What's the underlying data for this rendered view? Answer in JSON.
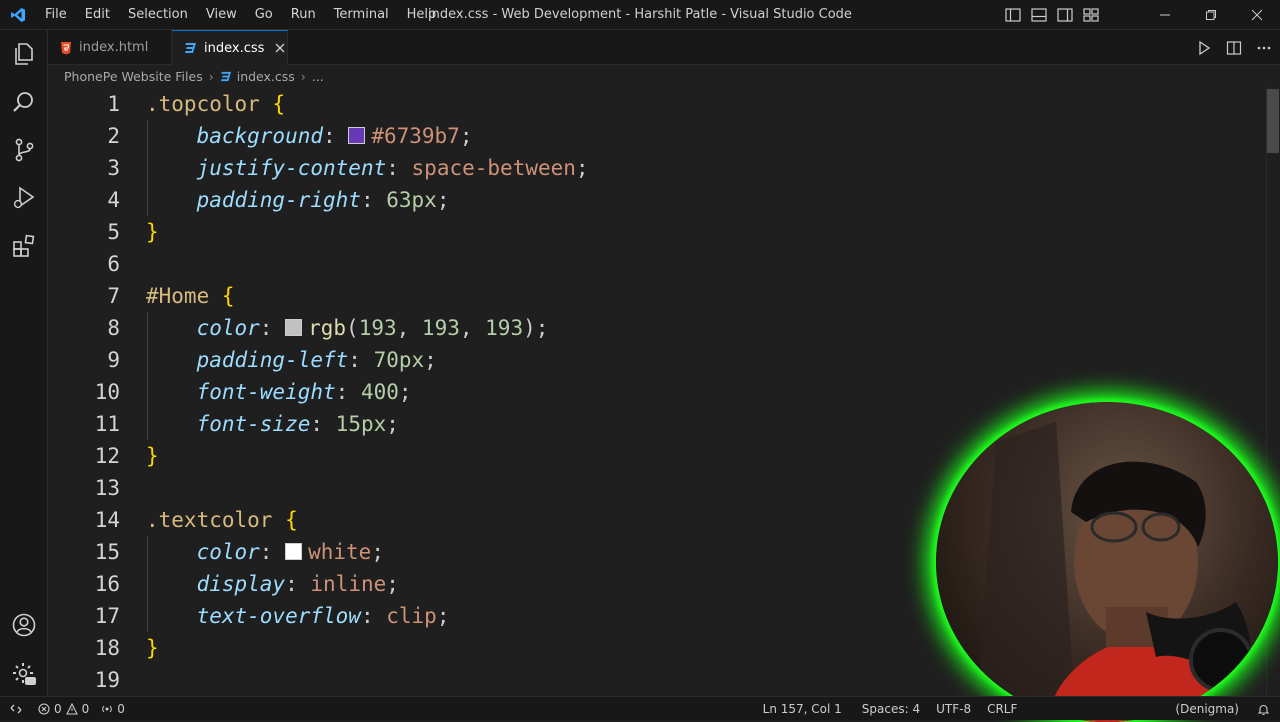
{
  "window": {
    "title": "index.css - Web Development - Harshit Patle - Visual Studio Code",
    "menu": [
      "File",
      "Edit",
      "Selection",
      "View",
      "Go",
      "Run",
      "Terminal",
      "Help"
    ]
  },
  "tabs": [
    {
      "label": "index.html",
      "icon": "html-file-icon",
      "active": false
    },
    {
      "label": "index.css",
      "icon": "css-file-icon",
      "active": true
    }
  ],
  "breadcrumb": {
    "folder": "PhonePe Website Files",
    "file": "index.css",
    "more": "..."
  },
  "activity_bar": [
    "explorer-icon",
    "search-icon",
    "source-control-icon",
    "run-debug-icon",
    "extensions-icon",
    "accounts-icon",
    "manage-gear-icon"
  ],
  "editor": {
    "line_numbers": [
      "1",
      "2",
      "3",
      "4",
      "5",
      "6",
      "7",
      "8",
      "9",
      "10",
      "11",
      "12",
      "13",
      "14",
      "15",
      "16",
      "17",
      "18",
      "19"
    ],
    "code": {
      "l1": {
        "selector": ".topcolor",
        "brace": "{"
      },
      "l2": {
        "prop": "background",
        "value": "#6739b7",
        "swatch": "#6739b7"
      },
      "l3": {
        "prop": "justify-content",
        "value": "space-between"
      },
      "l4": {
        "prop": "padding-right",
        "value": "63px"
      },
      "l5": {
        "brace": "}"
      },
      "l7": {
        "selector": "#Home",
        "brace": "{"
      },
      "l8": {
        "prop": "color",
        "fn": "rgb",
        "args": [
          "193",
          "193",
          "193"
        ],
        "swatch": "#c1c1c1"
      },
      "l9": {
        "prop": "padding-left",
        "value": "70px"
      },
      "l10": {
        "prop": "font-weight",
        "value": "400"
      },
      "l11": {
        "prop": "font-size",
        "value": "15px"
      },
      "l12": {
        "brace": "}"
      },
      "l14": {
        "selector": ".textcolor",
        "brace": "{"
      },
      "l15": {
        "prop": "color",
        "value": "white",
        "swatch": "#ffffff"
      },
      "l16": {
        "prop": "display",
        "value": "inline"
      },
      "l17": {
        "prop": "text-overflow",
        "value": "clip"
      },
      "l18": {
        "brace": "}"
      }
    }
  },
  "status_bar": {
    "errors": "0",
    "warnings": "0",
    "ports": "0",
    "position": "Ln 157, Col 1",
    "spaces": "Spaces: 4",
    "encoding": "UTF-8",
    "eol": "CRLF",
    "theme": "(Denigma)"
  },
  "colors": {
    "accent": "#0078d4",
    "editor_bg": "#1f1f1f",
    "webcam_glow": "#1aff1a"
  }
}
